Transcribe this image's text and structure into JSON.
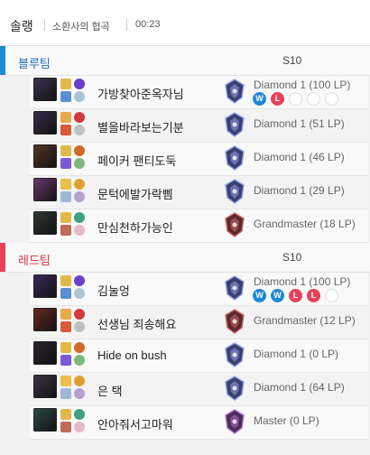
{
  "header": {
    "mode": "솔랭",
    "map": "소환사의 협곡",
    "time": "00:23"
  },
  "teams": [
    {
      "name": "블루팀",
      "season": "S10",
      "players": [
        {
          "name": "가방찾아준옥자님",
          "rank": "Diamond 1 (100 LP)",
          "champ_color": "#3c3552",
          "tier": "diamond",
          "history": [
            "W",
            "L",
            "",
            "",
            ""
          ]
        },
        {
          "name": "별을바라보는기분",
          "rank": "Diamond 1 (51 LP)",
          "champ_color": "#3a2a4a",
          "tier": "diamond",
          "history": []
        },
        {
          "name": "페이커 팬티도둑",
          "rank": "Diamond 1 (46 LP)",
          "champ_color": "#5a3524",
          "tier": "diamond",
          "history": []
        },
        {
          "name": "문턱에발가락삠",
          "rank": "Diamond 1 (29 LP)",
          "champ_color": "#6b3a6e",
          "tier": "diamond",
          "history": []
        },
        {
          "name": "만심천하가능인",
          "rank": "Grandmaster (18 LP)",
          "champ_color": "#2f3a33",
          "tier": "grandmaster",
          "history": []
        }
      ]
    },
    {
      "name": "레드팀",
      "season": "S10",
      "players": [
        {
          "name": "김눌엉",
          "rank": "Diamond 1 (100 LP)",
          "champ_color": "#3b2b5e",
          "tier": "diamond",
          "history": [
            "W",
            "W",
            "L",
            "L",
            ""
          ]
        },
        {
          "name": "선생님 죄송해요",
          "rank": "Grandmaster (12 LP)",
          "champ_color": "#6a2a20",
          "tier": "grandmaster",
          "history": []
        },
        {
          "name": "Hide on bush",
          "rank": "Diamond 1 (0 LP)",
          "champ_color": "#2a2530",
          "tier": "diamond",
          "history": []
        },
        {
          "name": "은 택",
          "rank": "Diamond 1 (64 LP)",
          "champ_color": "#3d3548",
          "tier": "diamond",
          "history": []
        },
        {
          "name": "안아줘서고마워",
          "rank": "Master (0 LP)",
          "champ_color": "#2c4a48",
          "tier": "master",
          "history": []
        }
      ]
    }
  ]
}
